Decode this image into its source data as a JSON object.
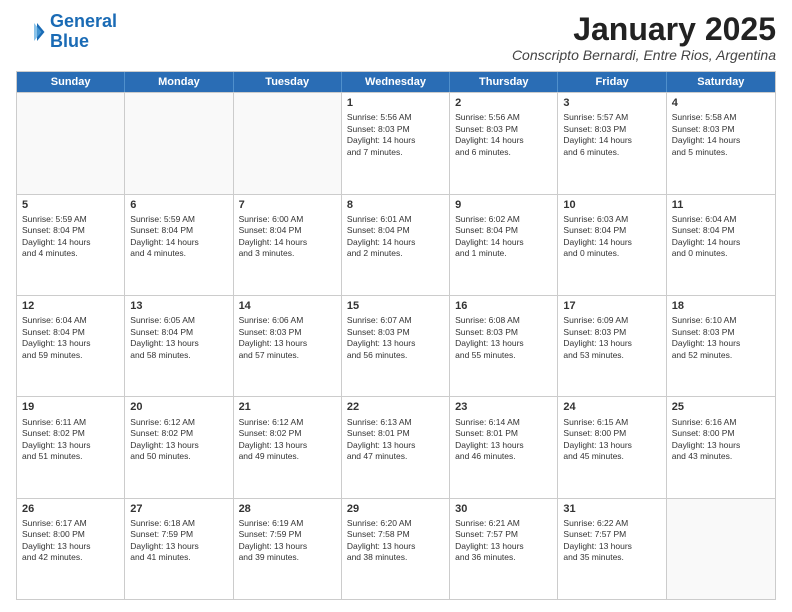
{
  "logo": {
    "line1": "General",
    "line2": "Blue"
  },
  "title": "January 2025",
  "subtitle": "Conscripto Bernardi, Entre Rios, Argentina",
  "days_of_week": [
    "Sunday",
    "Monday",
    "Tuesday",
    "Wednesday",
    "Thursday",
    "Friday",
    "Saturday"
  ],
  "weeks": [
    [
      {
        "day": "",
        "text": ""
      },
      {
        "day": "",
        "text": ""
      },
      {
        "day": "",
        "text": ""
      },
      {
        "day": "1",
        "text": "Sunrise: 5:56 AM\nSunset: 8:03 PM\nDaylight: 14 hours\nand 7 minutes."
      },
      {
        "day": "2",
        "text": "Sunrise: 5:56 AM\nSunset: 8:03 PM\nDaylight: 14 hours\nand 6 minutes."
      },
      {
        "day": "3",
        "text": "Sunrise: 5:57 AM\nSunset: 8:03 PM\nDaylight: 14 hours\nand 6 minutes."
      },
      {
        "day": "4",
        "text": "Sunrise: 5:58 AM\nSunset: 8:03 PM\nDaylight: 14 hours\nand 5 minutes."
      }
    ],
    [
      {
        "day": "5",
        "text": "Sunrise: 5:59 AM\nSunset: 8:04 PM\nDaylight: 14 hours\nand 4 minutes."
      },
      {
        "day": "6",
        "text": "Sunrise: 5:59 AM\nSunset: 8:04 PM\nDaylight: 14 hours\nand 4 minutes."
      },
      {
        "day": "7",
        "text": "Sunrise: 6:00 AM\nSunset: 8:04 PM\nDaylight: 14 hours\nand 3 minutes."
      },
      {
        "day": "8",
        "text": "Sunrise: 6:01 AM\nSunset: 8:04 PM\nDaylight: 14 hours\nand 2 minutes."
      },
      {
        "day": "9",
        "text": "Sunrise: 6:02 AM\nSunset: 8:04 PM\nDaylight: 14 hours\nand 1 minute."
      },
      {
        "day": "10",
        "text": "Sunrise: 6:03 AM\nSunset: 8:04 PM\nDaylight: 14 hours\nand 0 minutes."
      },
      {
        "day": "11",
        "text": "Sunrise: 6:04 AM\nSunset: 8:04 PM\nDaylight: 14 hours\nand 0 minutes."
      }
    ],
    [
      {
        "day": "12",
        "text": "Sunrise: 6:04 AM\nSunset: 8:04 PM\nDaylight: 13 hours\nand 59 minutes."
      },
      {
        "day": "13",
        "text": "Sunrise: 6:05 AM\nSunset: 8:04 PM\nDaylight: 13 hours\nand 58 minutes."
      },
      {
        "day": "14",
        "text": "Sunrise: 6:06 AM\nSunset: 8:03 PM\nDaylight: 13 hours\nand 57 minutes."
      },
      {
        "day": "15",
        "text": "Sunrise: 6:07 AM\nSunset: 8:03 PM\nDaylight: 13 hours\nand 56 minutes."
      },
      {
        "day": "16",
        "text": "Sunrise: 6:08 AM\nSunset: 8:03 PM\nDaylight: 13 hours\nand 55 minutes."
      },
      {
        "day": "17",
        "text": "Sunrise: 6:09 AM\nSunset: 8:03 PM\nDaylight: 13 hours\nand 53 minutes."
      },
      {
        "day": "18",
        "text": "Sunrise: 6:10 AM\nSunset: 8:03 PM\nDaylight: 13 hours\nand 52 minutes."
      }
    ],
    [
      {
        "day": "19",
        "text": "Sunrise: 6:11 AM\nSunset: 8:02 PM\nDaylight: 13 hours\nand 51 minutes."
      },
      {
        "day": "20",
        "text": "Sunrise: 6:12 AM\nSunset: 8:02 PM\nDaylight: 13 hours\nand 50 minutes."
      },
      {
        "day": "21",
        "text": "Sunrise: 6:12 AM\nSunset: 8:02 PM\nDaylight: 13 hours\nand 49 minutes."
      },
      {
        "day": "22",
        "text": "Sunrise: 6:13 AM\nSunset: 8:01 PM\nDaylight: 13 hours\nand 47 minutes."
      },
      {
        "day": "23",
        "text": "Sunrise: 6:14 AM\nSunset: 8:01 PM\nDaylight: 13 hours\nand 46 minutes."
      },
      {
        "day": "24",
        "text": "Sunrise: 6:15 AM\nSunset: 8:00 PM\nDaylight: 13 hours\nand 45 minutes."
      },
      {
        "day": "25",
        "text": "Sunrise: 6:16 AM\nSunset: 8:00 PM\nDaylight: 13 hours\nand 43 minutes."
      }
    ],
    [
      {
        "day": "26",
        "text": "Sunrise: 6:17 AM\nSunset: 8:00 PM\nDaylight: 13 hours\nand 42 minutes."
      },
      {
        "day": "27",
        "text": "Sunrise: 6:18 AM\nSunset: 7:59 PM\nDaylight: 13 hours\nand 41 minutes."
      },
      {
        "day": "28",
        "text": "Sunrise: 6:19 AM\nSunset: 7:59 PM\nDaylight: 13 hours\nand 39 minutes."
      },
      {
        "day": "29",
        "text": "Sunrise: 6:20 AM\nSunset: 7:58 PM\nDaylight: 13 hours\nand 38 minutes."
      },
      {
        "day": "30",
        "text": "Sunrise: 6:21 AM\nSunset: 7:57 PM\nDaylight: 13 hours\nand 36 minutes."
      },
      {
        "day": "31",
        "text": "Sunrise: 6:22 AM\nSunset: 7:57 PM\nDaylight: 13 hours\nand 35 minutes."
      },
      {
        "day": "",
        "text": ""
      }
    ]
  ]
}
